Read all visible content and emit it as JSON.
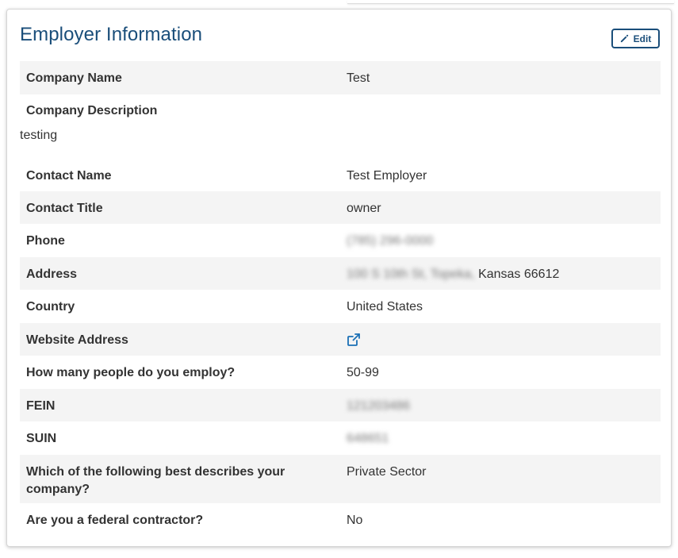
{
  "card": {
    "title": "Employer Information",
    "edit_label": "Edit"
  },
  "company_name": {
    "label": "Company Name",
    "value": "Test"
  },
  "company_description": {
    "label": "Company Description",
    "value": "testing"
  },
  "contact_name": {
    "label": "Contact Name",
    "value": "Test Employer"
  },
  "contact_title": {
    "label": "Contact Title",
    "value": "owner"
  },
  "phone": {
    "label": "Phone",
    "value": "(785) 296-0000"
  },
  "address": {
    "label": "Address",
    "street_city": "100 S 10th St, Topeka,",
    "state_zip": "Kansas 66612"
  },
  "country": {
    "label": "Country",
    "value": "United States"
  },
  "website": {
    "label": "Website Address",
    "icon": "external-link-icon"
  },
  "employees": {
    "label": "How many people do you employ?",
    "value": "50-99"
  },
  "fein": {
    "label": "FEIN",
    "value": "121203486"
  },
  "suin": {
    "label": "SUIN",
    "value": "648651"
  },
  "sector": {
    "label": "Which of the following best describes your company?",
    "value": "Private Sector"
  },
  "federal_contractor": {
    "label": "Are you a federal contractor?",
    "value": "No"
  },
  "colors": {
    "title": "#1a4e7a",
    "link": "#1a6fb5",
    "row_shade": "#f4f4f4"
  }
}
